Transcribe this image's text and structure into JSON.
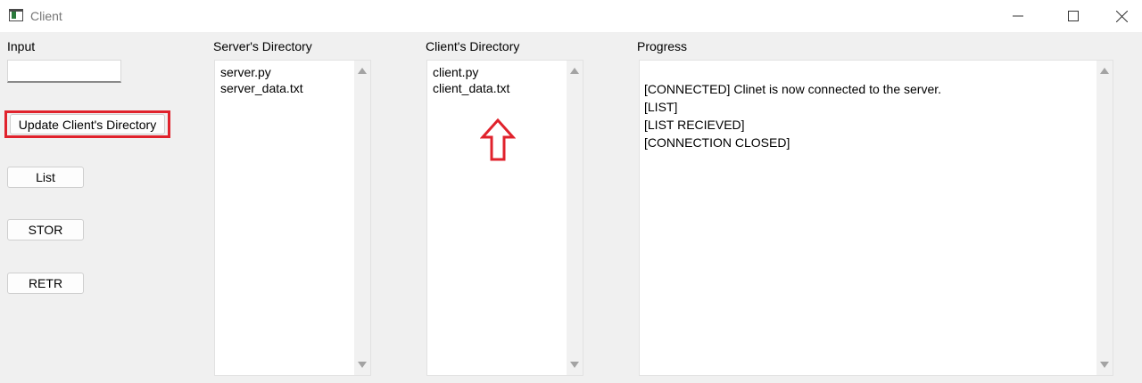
{
  "window": {
    "title": "Client",
    "icons": [
      "app-icon",
      "minimize-icon",
      "maximize-icon",
      "close-icon"
    ]
  },
  "input": {
    "label": "Input",
    "value": ""
  },
  "buttons": {
    "update_client_dir": "Update Client's Directory",
    "list": "List",
    "stor": "STOR",
    "retr": "RETR"
  },
  "server_directory": {
    "label": "Server's Directory",
    "files": [
      "server.py",
      "server_data.txt"
    ]
  },
  "client_directory": {
    "label": "Client's Directory",
    "files": [
      "client.py",
      "client_data.txt"
    ]
  },
  "progress": {
    "label": "Progress",
    "lines": [
      "[CONNECTED] Clinet is now connected to the server.",
      "[LIST]",
      "[LIST RECIEVED]",
      "[CONNECTION CLOSED]"
    ]
  },
  "annotations": {
    "highlight_color": "#e0222c",
    "arrow_icon": "up-arrow-icon"
  }
}
